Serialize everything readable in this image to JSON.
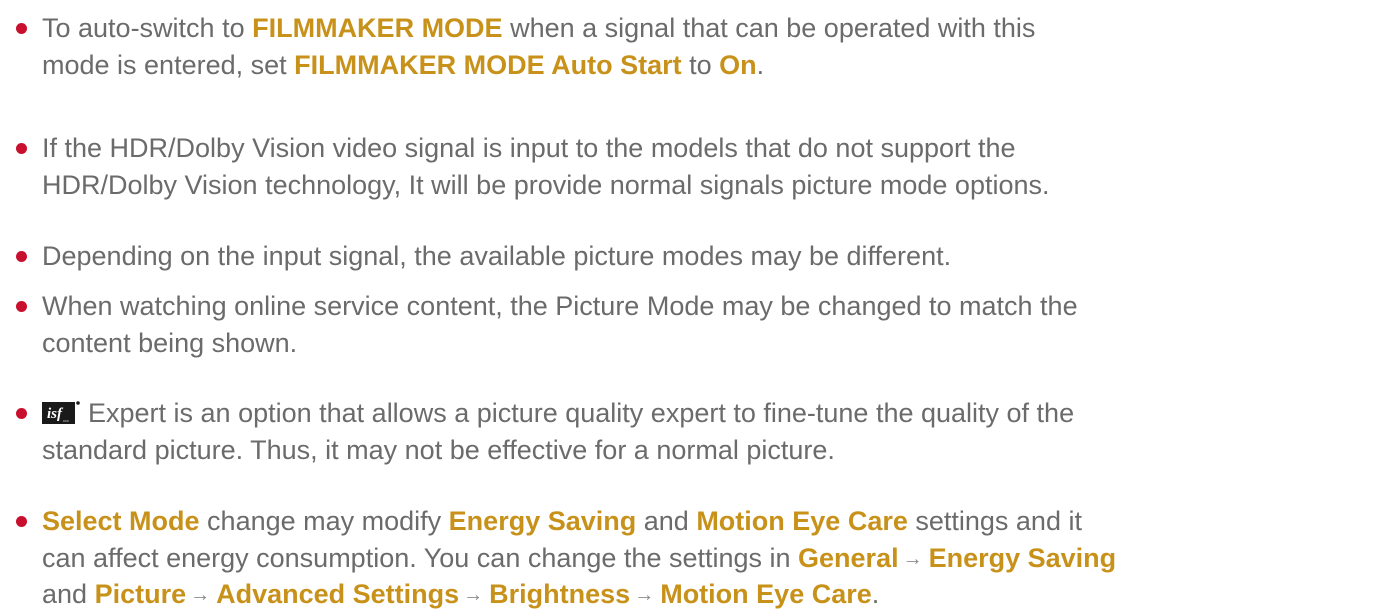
{
  "notes": [
    {
      "lines": [
        [
          "To auto-switch to ",
          {
            "hl": "FILMMAKER MODE"
          },
          " when a signal that can be operated with this"
        ],
        [
          "mode is entered, set ",
          {
            "hl": "FILMMAKER MODE Auto Start"
          },
          " to ",
          {
            "hl": "On"
          },
          "."
        ]
      ]
    },
    {
      "lines": [
        [
          "If the HDR/Dolby Vision video signal is input to the models that do not support the"
        ],
        [
          "HDR/Dolby Vision technology, It will be provide normal signals picture mode options."
        ]
      ]
    },
    {
      "lines": [
        [
          "Depending on the input signal, the available picture modes may be different."
        ]
      ]
    },
    {
      "lines": [
        [
          "When watching online service content, the Picture Mode may be changed to match the"
        ],
        [
          "content being shown."
        ]
      ]
    },
    {
      "lines": [
        [
          {
            "icon": "isf-logo-icon"
          },
          "Expert is an option that allows a picture quality expert to fine-tune the quality of the"
        ],
        [
          "standard picture. Thus, it may not be effective for a normal picture."
        ]
      ]
    },
    {
      "lines": [
        [
          {
            "hl": "Select Mode"
          },
          " change may modify ",
          {
            "hl": "Energy Saving"
          },
          " and ",
          {
            "hl": "Motion Eye Care"
          },
          " settings and it"
        ],
        [
          "can affect energy consumption. You can change the settings in ",
          {
            "hl": "General"
          },
          {
            "arrow": "→"
          },
          {
            "hl": "Energy Saving"
          }
        ],
        [
          "and ",
          {
            "hl": "Picture"
          },
          {
            "arrow": "→"
          },
          {
            "hl": "Advanced Settings"
          },
          {
            "arrow": "→"
          },
          {
            "hl": "Brightness"
          },
          {
            "arrow": "→"
          },
          {
            "hl": "Motion Eye Care"
          },
          "."
        ]
      ]
    }
  ],
  "colors": {
    "bullet": "#c8102e",
    "highlight": "#c8921a",
    "text": "#6b6b6b"
  }
}
